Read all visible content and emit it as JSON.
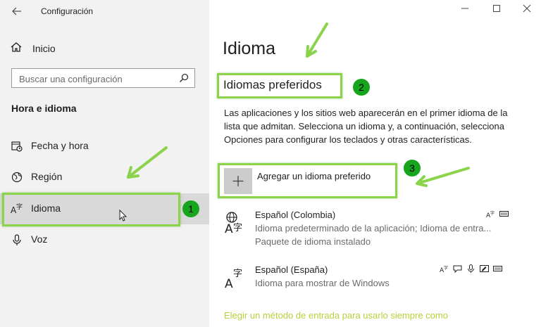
{
  "window": {
    "title": "Configuración"
  },
  "sidebar": {
    "home_label": "Inicio",
    "search_placeholder": "Buscar una configuración",
    "section_heading": "Hora e idioma",
    "items": [
      {
        "label": "Fecha y hora",
        "icon": "calendar-clock-icon"
      },
      {
        "label": "Región",
        "icon": "globe-region-icon"
      },
      {
        "label": "Idioma",
        "icon": "language-icon",
        "selected": true
      },
      {
        "label": "Voz",
        "icon": "microphone-icon"
      }
    ]
  },
  "main": {
    "title": "Idioma",
    "preferred_heading": "Idiomas preferidos",
    "description": "Las aplicaciones y los sitios web aparecerán en el primer idioma de la lista que admitan. Selecciona un idioma y, a continuación, selecciona Opciones para configurar los teclados y otras características.",
    "add_language_label": "Agregar un idioma preferido",
    "languages": [
      {
        "name": "Español (Colombia)",
        "detail1": "Idioma predeterminado de la aplicación; Idioma de entra...",
        "detail2": "Paquete de idioma instalado",
        "features": [
          "display-language-icon",
          "keyboard-icon"
        ]
      },
      {
        "name": "Español (España)",
        "detail1": "Idioma para mostrar de Windows",
        "features": [
          "display-language-icon",
          "speech-bubble-icon",
          "microphone-icon",
          "handwriting-icon",
          "keyboard-icon"
        ]
      }
    ],
    "footer_link": "Elegir un método de entrada para usarlo siempre como"
  },
  "annotations": {
    "badges": [
      "1",
      "2",
      "3"
    ],
    "highlight_color": "#8bd34a",
    "badge_color": "#17a51d"
  }
}
